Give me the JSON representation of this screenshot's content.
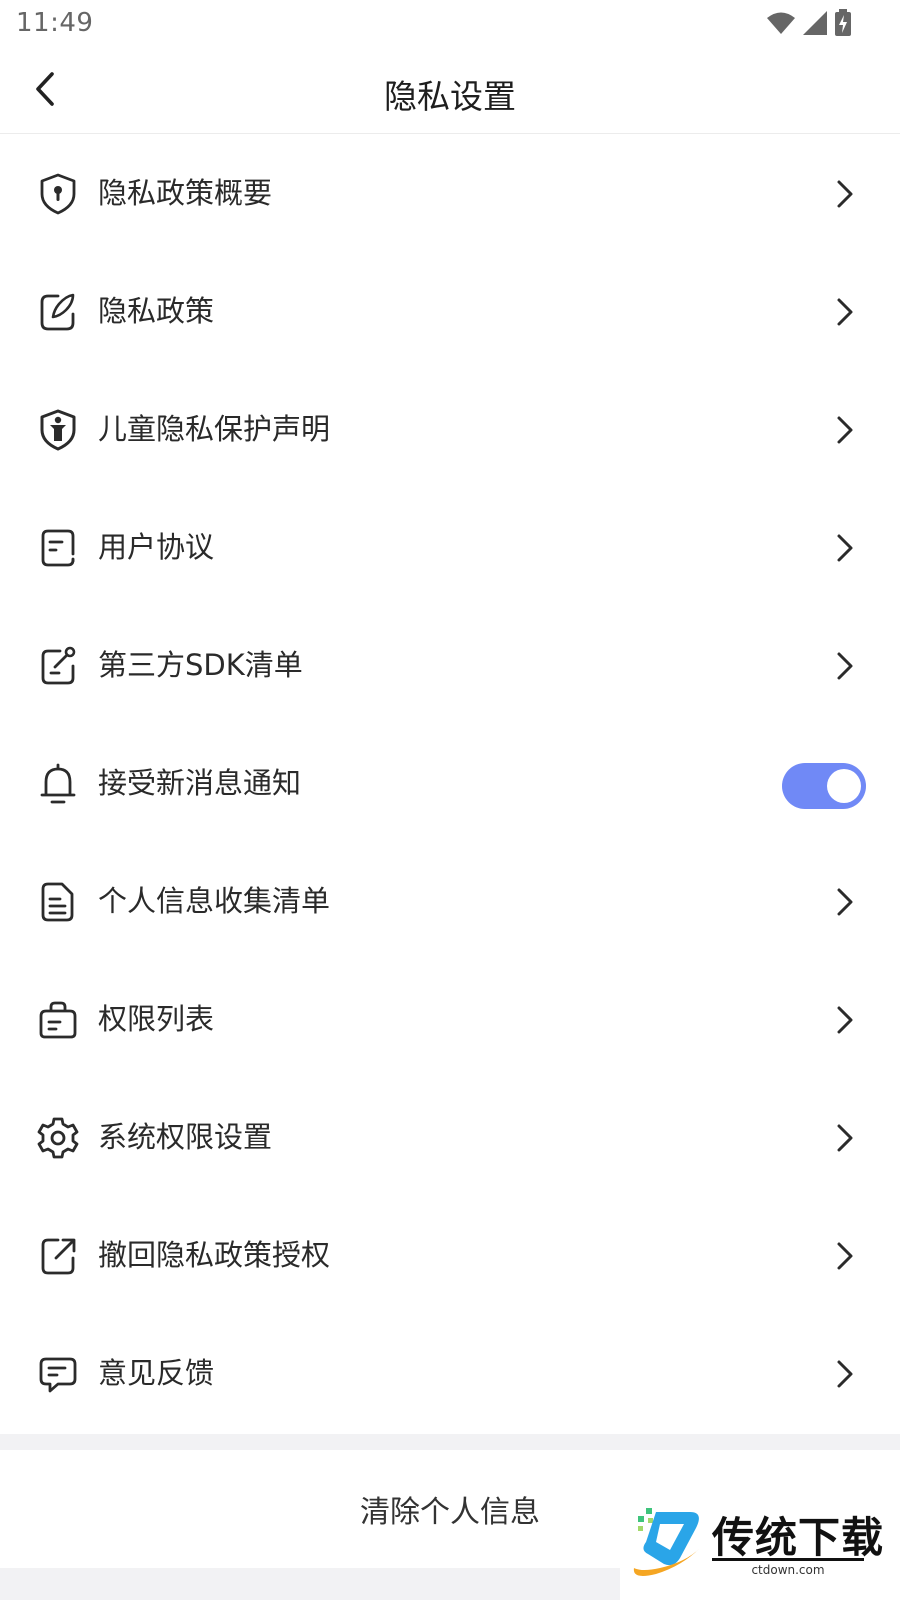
{
  "status_bar": {
    "time": "11:49",
    "icons": [
      "wifi-icon",
      "signal-icon",
      "battery-charging-icon"
    ]
  },
  "header": {
    "title": "隐私设置",
    "back_icon": "chevron-left-icon"
  },
  "settings": [
    {
      "label": "隐私政策概要",
      "icon": "shield-lock-icon",
      "trailing": "chevron"
    },
    {
      "label": "隐私政策",
      "icon": "edit-pen-icon",
      "trailing": "chevron"
    },
    {
      "label": "儿童隐私保护声明",
      "icon": "child-shield-icon",
      "trailing": "chevron"
    },
    {
      "label": "用户协议",
      "icon": "document-icon",
      "trailing": "chevron"
    },
    {
      "label": "第三方SDK清单",
      "icon": "sdk-link-icon",
      "trailing": "chevron"
    },
    {
      "label": "接受新消息通知",
      "icon": "bell-icon",
      "trailing": "toggle",
      "enabled": true
    },
    {
      "label": "个人信息收集清单",
      "icon": "file-list-icon",
      "trailing": "chevron"
    },
    {
      "label": "权限列表",
      "icon": "briefcase-list-icon",
      "trailing": "chevron"
    },
    {
      "label": "系统权限设置",
      "icon": "gear-icon",
      "trailing": "chevron"
    },
    {
      "label": "撤回隐私政策授权",
      "icon": "share-out-icon",
      "trailing": "chevron"
    },
    {
      "label": "意见反馈",
      "icon": "message-icon",
      "trailing": "chevron"
    }
  ],
  "clear_button": {
    "label": "清除个人信息"
  },
  "watermark": {
    "text": "传统下载",
    "domain": "ctdown.com"
  },
  "colors": {
    "accent": "#7089f6",
    "text": "#2a2a2a",
    "divider": "#ececec",
    "band": "#f2f2f4"
  }
}
